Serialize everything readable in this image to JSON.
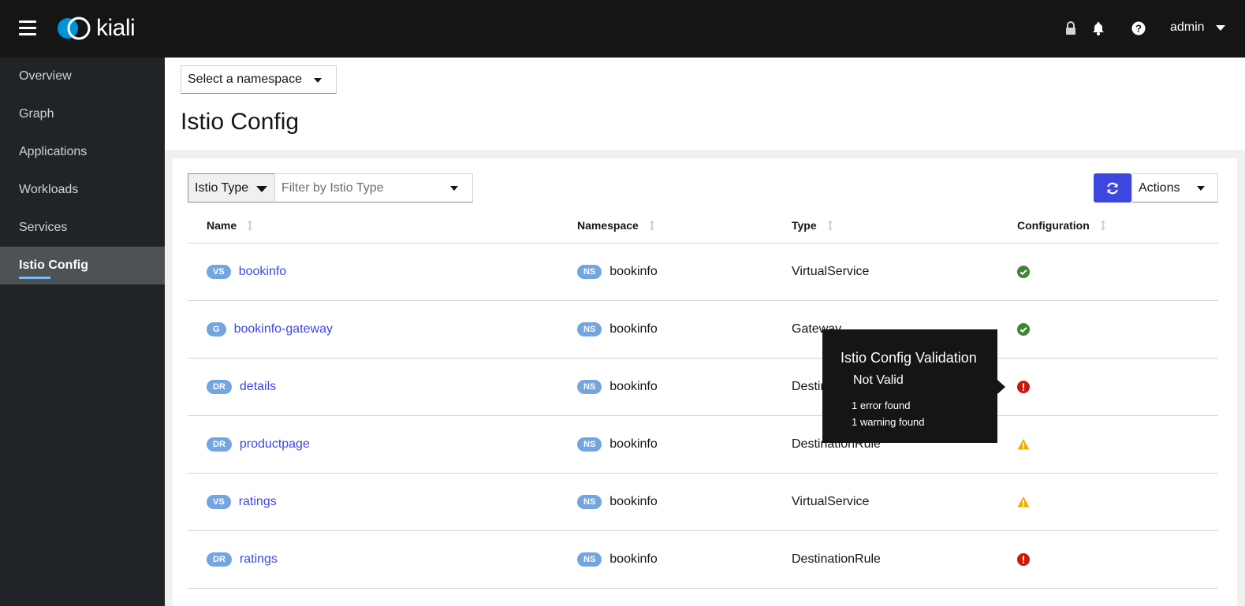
{
  "masthead": {
    "brand": "kiali",
    "user": "admin",
    "icons": [
      "menu-icon",
      "lock-icon",
      "bell-icon",
      "help-icon"
    ]
  },
  "sidebar": {
    "items": [
      {
        "label": "Overview",
        "active": false
      },
      {
        "label": "Graph",
        "active": false
      },
      {
        "label": "Applications",
        "active": false
      },
      {
        "label": "Workloads",
        "active": false
      },
      {
        "label": "Services",
        "active": false
      },
      {
        "label": "Istio Config",
        "active": true
      }
    ]
  },
  "header": {
    "namespace_select": "Select a namespace",
    "title": "Istio Config"
  },
  "toolbar": {
    "filter_type": "Istio Type",
    "filter_placeholder": "Filter by Istio Type",
    "actions_label": "Actions"
  },
  "table": {
    "columns": [
      "Name",
      "Namespace",
      "Type",
      "Configuration"
    ],
    "rows": [
      {
        "badge": "VS",
        "name": "bookinfo",
        "ns_badge": "NS",
        "namespace": "bookinfo",
        "type": "VirtualService",
        "status": "valid"
      },
      {
        "badge": "G",
        "name": "bookinfo-gateway",
        "ns_badge": "NS",
        "namespace": "bookinfo",
        "type": "Gateway",
        "status": "valid"
      },
      {
        "badge": "DR",
        "name": "details",
        "ns_badge": "NS",
        "namespace": "bookinfo",
        "type": "DestinationRule",
        "status": "error"
      },
      {
        "badge": "DR",
        "name": "productpage",
        "ns_badge": "NS",
        "namespace": "bookinfo",
        "type": "DestinationRule",
        "status": "warning"
      },
      {
        "badge": "VS",
        "name": "ratings",
        "ns_badge": "NS",
        "namespace": "bookinfo",
        "type": "VirtualService",
        "status": "warning"
      },
      {
        "badge": "DR",
        "name": "ratings",
        "ns_badge": "NS",
        "namespace": "bookinfo",
        "type": "DestinationRule",
        "status": "error"
      }
    ]
  },
  "tooltip": {
    "title": "Istio Config Validation",
    "status": "Not Valid",
    "errors": "1 error found",
    "warnings": "1 warning found"
  },
  "colors": {
    "masthead": "#151515",
    "sidebar": "#212427",
    "accent": "#3e46e0",
    "valid": "#3e8635",
    "error": "#c9190b",
    "warning": "#f0ab00"
  }
}
